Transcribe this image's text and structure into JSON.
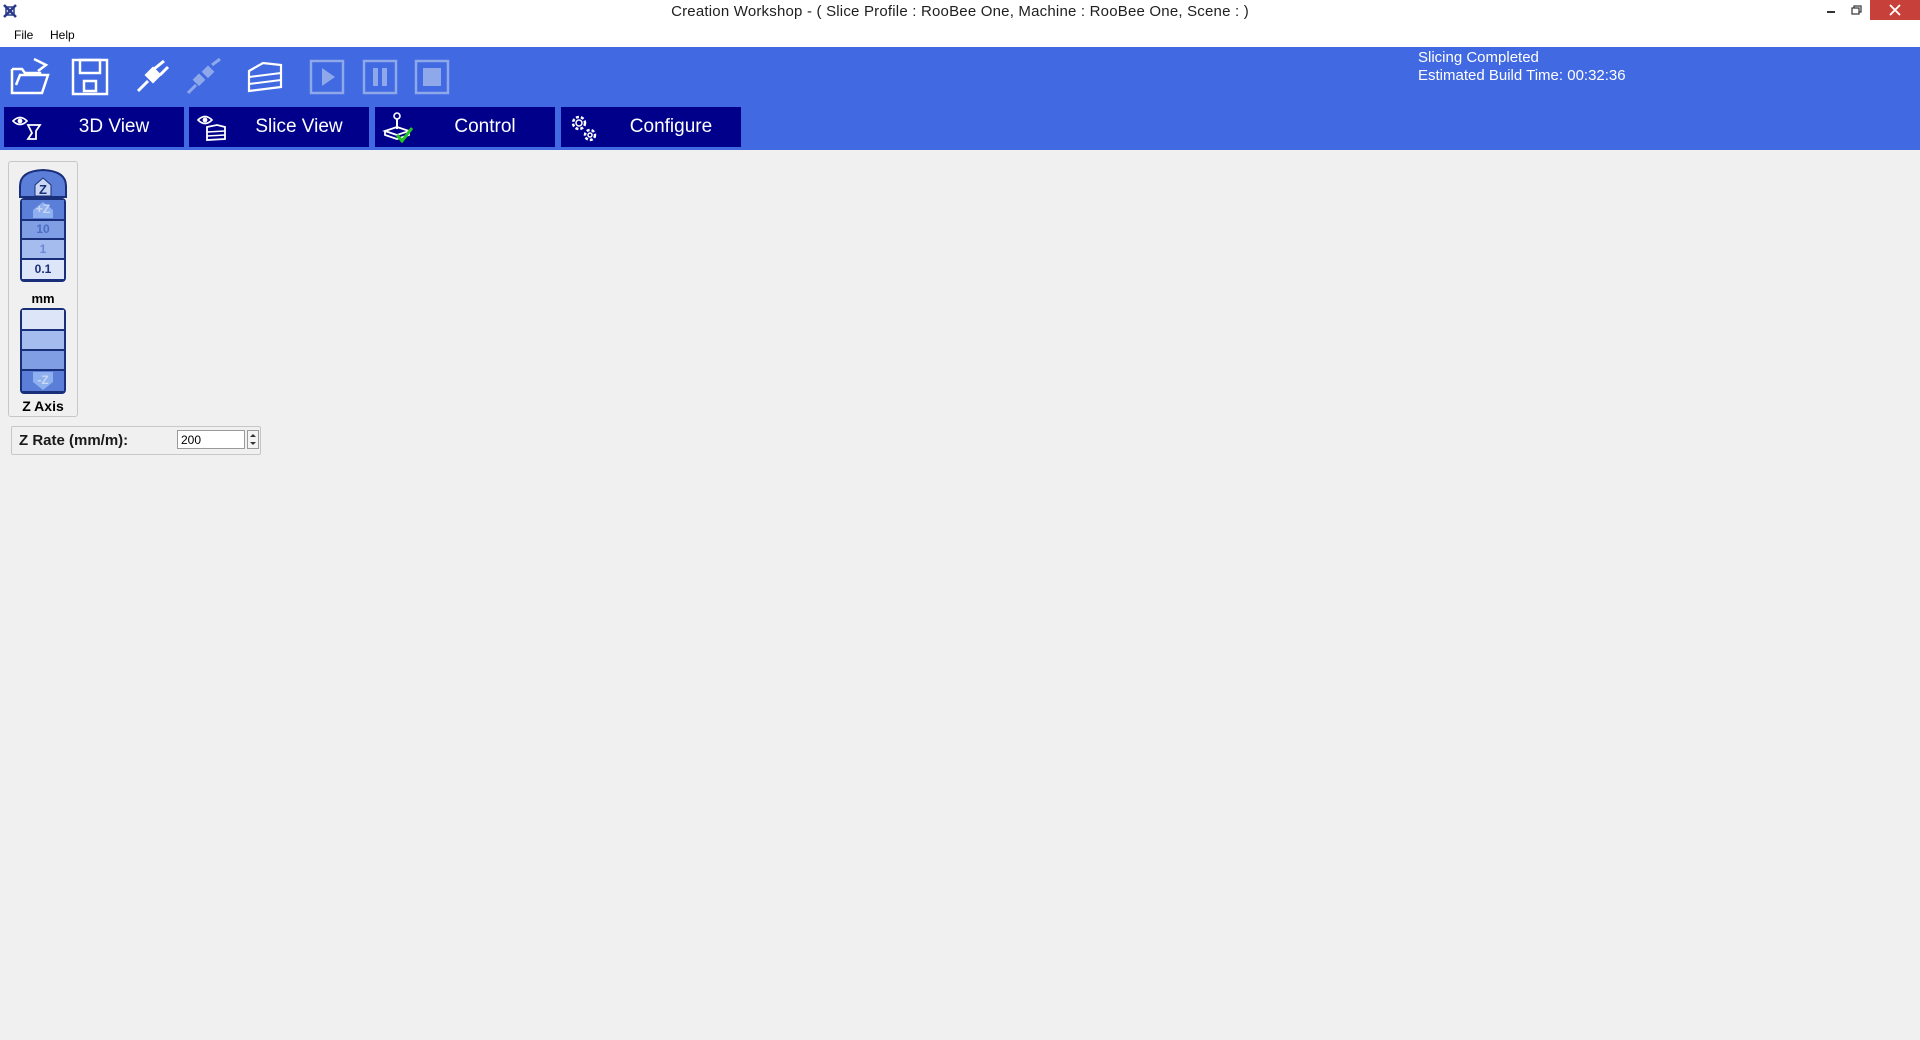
{
  "window": {
    "title": "Creation Workshop -   ( Slice Profile : RooBee One, Machine : RooBee One, Scene : )"
  },
  "menu": {
    "items": [
      {
        "label": "File"
      },
      {
        "label": "Help"
      }
    ]
  },
  "toolbar": {
    "icons": [
      "open-folder-icon",
      "save-icon",
      "connect-icon",
      "disconnect-icon",
      "slice-icon",
      "play-icon",
      "pause-icon",
      "stop-icon"
    ]
  },
  "status": {
    "line1": "Slicing Completed",
    "line2": "Estimated Build Time: 00:32:36"
  },
  "tabs": [
    {
      "label": "3D View",
      "icon": "eye-3d-icon"
    },
    {
      "label": "Slice View",
      "icon": "eye-slice-icon"
    },
    {
      "label": "Control",
      "icon": "joystick-icon"
    },
    {
      "label": "Configure",
      "icon": "gears-icon"
    }
  ],
  "zaxis": {
    "home_label": "Z",
    "up_label": "+Z",
    "steps": [
      "10",
      "1",
      "0.1"
    ],
    "unit": "mm",
    "down_label": "-Z",
    "title": "Z Axis"
  },
  "zrate": {
    "label": "Z Rate (mm/m):",
    "value": "200"
  },
  "colors": {
    "toolbar_bg": "#4169e1",
    "tab_bg": "#00008b",
    "close_button": "#c7413a"
  }
}
